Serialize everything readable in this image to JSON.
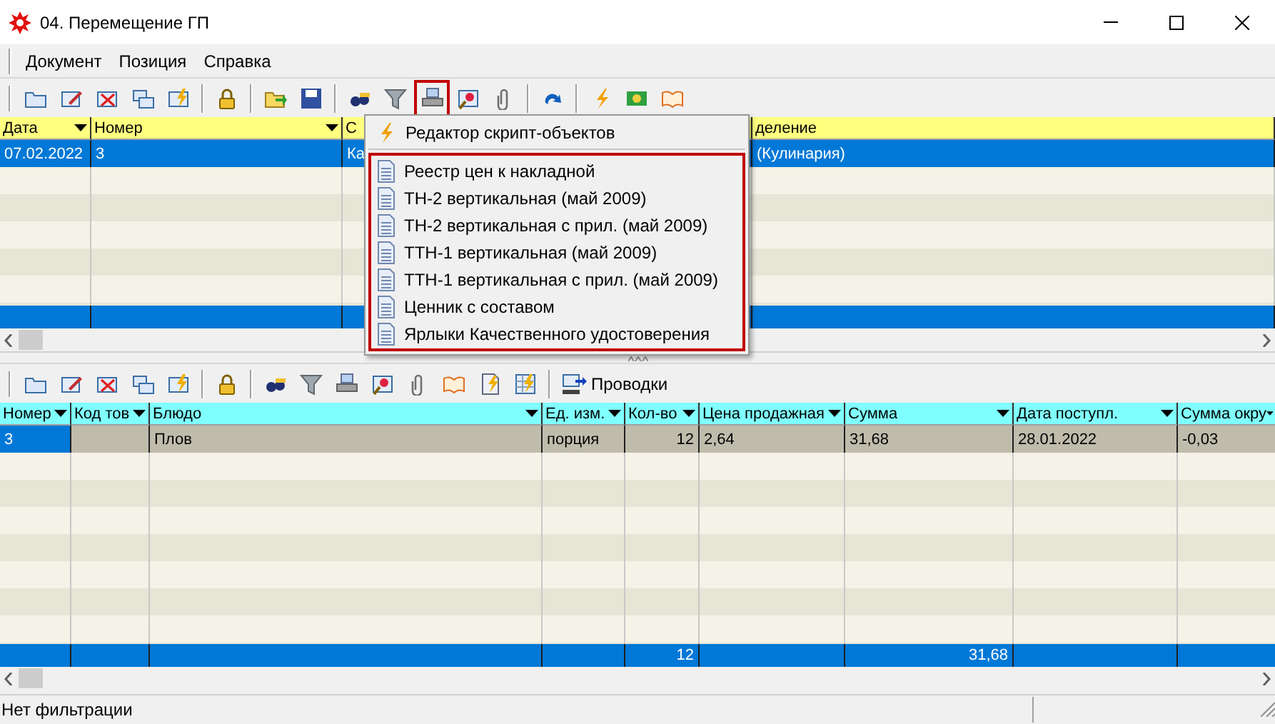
{
  "window": {
    "title": "04. Перемещение ГП"
  },
  "menu_bar": [
    "Документ",
    "Позиция",
    "Справка"
  ],
  "top_toolbar": {
    "print_button_highlighted": true
  },
  "top_grid": {
    "columns": [
      "Дата",
      "Номер",
      "С",
      "деление"
    ],
    "rows": [
      {
        "cells": [
          "07.02.2022",
          "3",
          "Ка",
          "(Кулинария)"
        ],
        "selected": true
      }
    ]
  },
  "popup_menu": {
    "script_item": "Редактор скрипт-объектов",
    "highlighted_group": true,
    "report_items": [
      "Реестр цен к накладной",
      "ТН-2 вертикальная (май 2009)",
      "ТН-2 вертикальная с прил. (май 2009)",
      "ТТН-1 вертикальная (май 2009)",
      "ТТН-1 вертикальная с прил. (май 2009)",
      "Ценник с составом",
      "Ярлыки Качественного удостоверения"
    ]
  },
  "lower_toolbar": {
    "postings_button": "Проводки"
  },
  "lower_grid": {
    "columns": [
      "Номер",
      "Код тов",
      "Блюдо",
      "Ед. изм.",
      "Кол-во",
      "Цена продажная",
      "Сумма",
      "Дата поступл.",
      "Сумма окру"
    ],
    "rows": [
      {
        "cells": [
          "3",
          "",
          "Плов",
          "порция",
          "12",
          "2,64",
          "31,68",
          "28.01.2022",
          "-0,03"
        ],
        "selected": true
      }
    ],
    "totals": {
      "quantity": "12",
      "amount": "31,68"
    }
  },
  "status_bar": "Нет фильтрации"
}
